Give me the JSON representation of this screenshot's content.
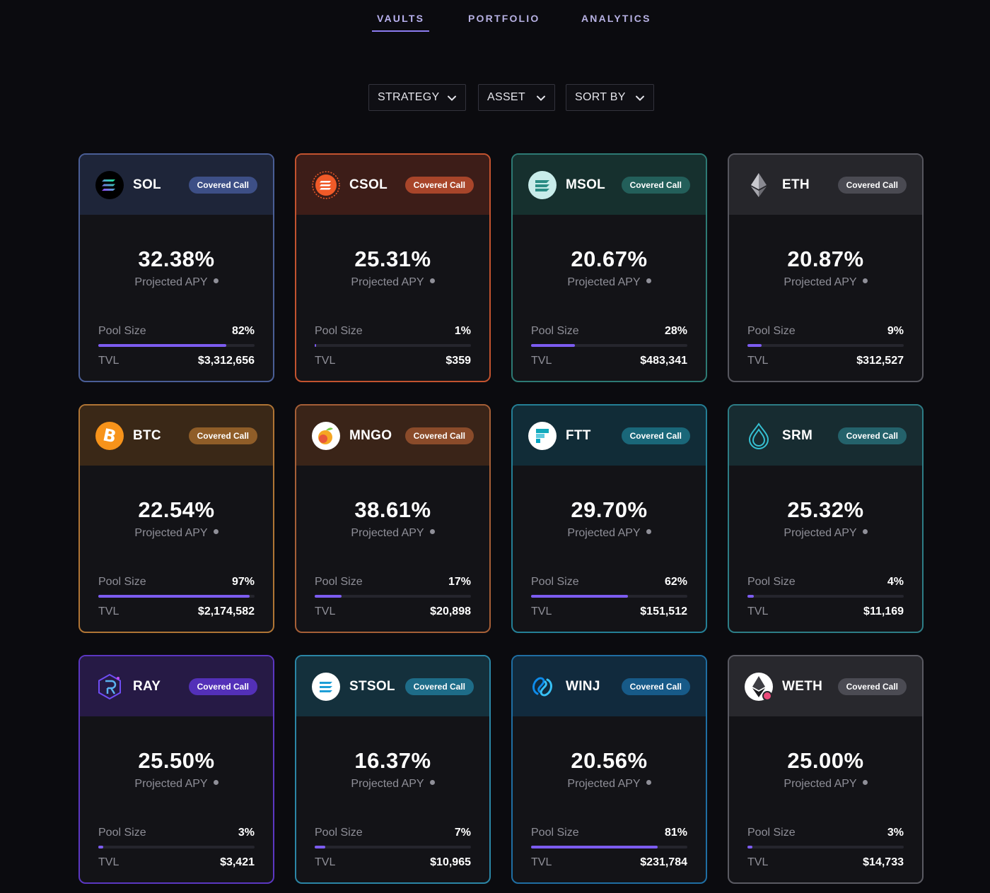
{
  "nav": {
    "tabs": [
      {
        "label": "VAULTS",
        "active": true
      },
      {
        "label": "PORTFOLIO",
        "active": false
      },
      {
        "label": "ANALYTICS",
        "active": false
      }
    ]
  },
  "filters": [
    {
      "label": "STRATEGY"
    },
    {
      "label": "ASSET"
    },
    {
      "label": "SORT BY"
    }
  ],
  "common": {
    "apy_label": "Projected APY",
    "pool_label": "Pool Size",
    "tvl_label": "TVL"
  },
  "vaults": [
    {
      "name": "SOL",
      "badge": "Covered Call",
      "apy": "32.38%",
      "pool_size": "82%",
      "pool_fraction": 0.82,
      "tvl": "$3,312,656",
      "icon": "solana-icon",
      "border": "#4a5e96",
      "header_bg": "#1e2539",
      "badge_bg": "#3d4f86"
    },
    {
      "name": "CSOL",
      "badge": "Covered Call",
      "apy": "25.31%",
      "pool_size": "1%",
      "pool_fraction": 0.01,
      "tvl": "$359",
      "icon": "csol-icon",
      "border": "#c3532f",
      "header_bg": "#3d1d18",
      "badge_bg": "#a8452a"
    },
    {
      "name": "MSOL",
      "badge": "Covered Call",
      "apy": "20.67%",
      "pool_size": "28%",
      "pool_fraction": 0.28,
      "tvl": "$483,341",
      "icon": "msol-icon",
      "border": "#2d7a74",
      "header_bg": "#16302e",
      "badge_bg": "#235f5a"
    },
    {
      "name": "ETH",
      "badge": "Covered Call",
      "apy": "20.87%",
      "pool_size": "9%",
      "pool_fraction": 0.09,
      "tvl": "$312,527",
      "icon": "ethereum-icon",
      "border": "#56565e",
      "header_bg": "#26262b",
      "badge_bg": "#4a4a52"
    },
    {
      "name": "BTC",
      "badge": "Covered Call",
      "apy": "22.54%",
      "pool_size": "97%",
      "pool_fraction": 0.97,
      "tvl": "$2,174,582",
      "icon": "bitcoin-icon",
      "border": "#b07535",
      "header_bg": "#3a2817",
      "badge_bg": "#8f5d28"
    },
    {
      "name": "MNGO",
      "badge": "Covered Call",
      "apy": "38.61%",
      "pool_size": "17%",
      "pool_fraction": 0.17,
      "tvl": "$20,898",
      "icon": "mango-icon",
      "border": "#a65f37",
      "header_bg": "#3a2418",
      "badge_bg": "#8a4b2a"
    },
    {
      "name": "FTT",
      "badge": "Covered Call",
      "apy": "29.70%",
      "pool_size": "62%",
      "pool_fraction": 0.62,
      "tvl": "$151,512",
      "icon": "ftx-icon",
      "border": "#247f96",
      "header_bg": "#112c37",
      "badge_bg": "#1a6779"
    },
    {
      "name": "SRM",
      "badge": "Covered Call",
      "apy": "25.32%",
      "pool_size": "4%",
      "pool_fraction": 0.04,
      "tvl": "$11,169",
      "icon": "serum-icon",
      "border": "#2d7d86",
      "header_bg": "#172c31",
      "badge_bg": "#24626b"
    },
    {
      "name": "RAY",
      "badge": "Covered Call",
      "apy": "25.50%",
      "pool_size": "3%",
      "pool_fraction": 0.03,
      "tvl": "$3,421",
      "icon": "raydium-icon",
      "border": "#5b37c2",
      "header_bg": "#261a45",
      "badge_bg": "#5330b8"
    },
    {
      "name": "STSOL",
      "badge": "Covered Call",
      "apy": "16.37%",
      "pool_size": "7%",
      "pool_fraction": 0.07,
      "tvl": "$10,965",
      "icon": "stsol-icon",
      "border": "#2b86a6",
      "header_bg": "#14303c",
      "badge_bg": "#1e6c88"
    },
    {
      "name": "WINJ",
      "badge": "Covered Call",
      "apy": "20.56%",
      "pool_size": "81%",
      "pool_fraction": 0.81,
      "tvl": "$231,784",
      "icon": "injective-icon",
      "border": "#1f6ea3",
      "header_bg": "#112a3d",
      "badge_bg": "#175a88"
    },
    {
      "name": "WETH",
      "badge": "Covered Call",
      "apy": "25.00%",
      "pool_size": "3%",
      "pool_fraction": 0.03,
      "tvl": "$14,733",
      "icon": "wrapped-ethereum-icon",
      "border": "#5a5a62",
      "header_bg": "#28282d",
      "badge_bg": "#4b4b53"
    }
  ]
}
